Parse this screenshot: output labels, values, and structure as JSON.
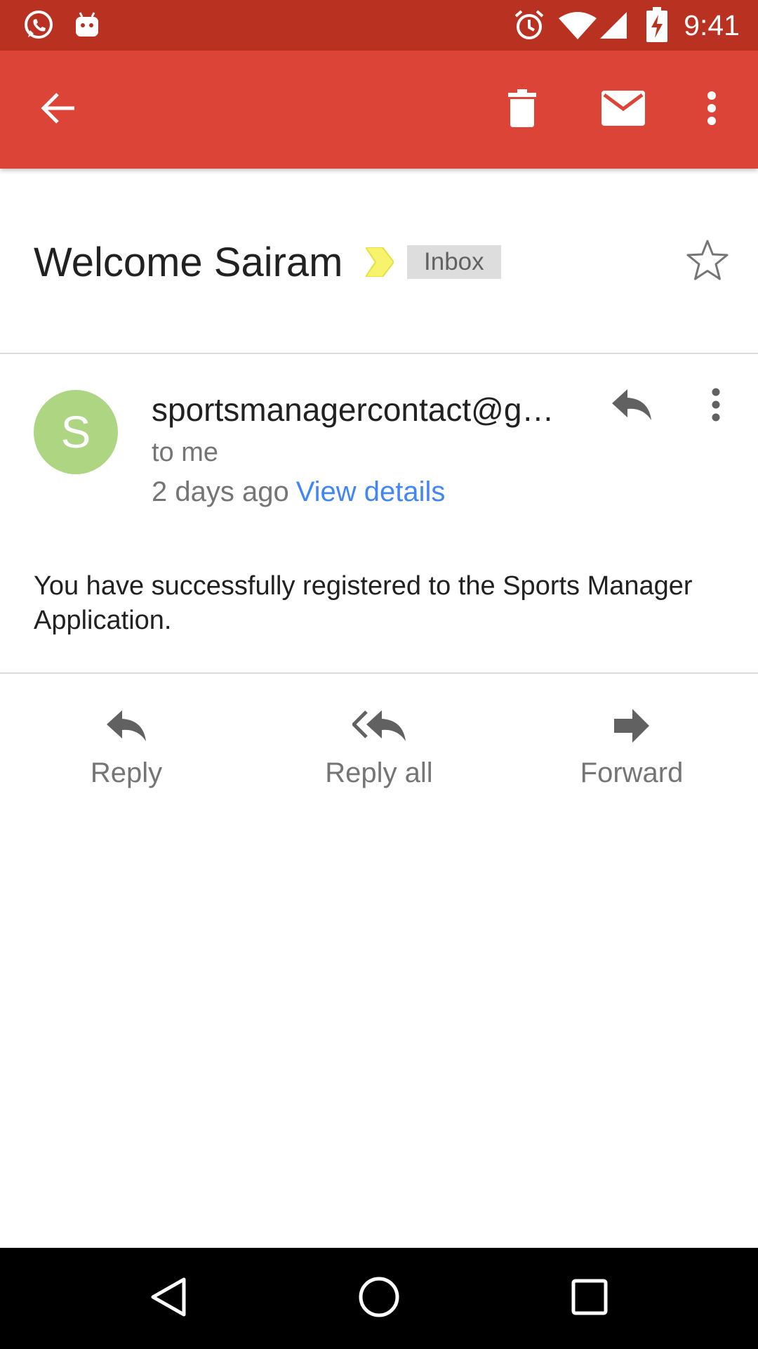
{
  "status_bar": {
    "time": "9:41",
    "icons": [
      "whatsapp-icon",
      "android-icon",
      "alarm-icon",
      "wifi-icon",
      "cell-signal-icon",
      "battery-charging-icon"
    ]
  },
  "app_bar": {
    "icons": [
      "back-arrow-icon",
      "delete-icon",
      "mail-icon",
      "more-vert-icon"
    ],
    "colors": {
      "status_bar": "#b93221",
      "toolbar": "#db4437"
    }
  },
  "subject": {
    "title": "Welcome Sairam",
    "label": "Inbox",
    "marker_color": "#f8f36c"
  },
  "message": {
    "avatar_letter": "S",
    "avatar_color": "#aed581",
    "sender": "sportsmanagercontact@g…",
    "recipient": "to me",
    "time": "2 days ago",
    "view_details": "View details",
    "link_color": "#4285f4",
    "body": "You have successfully registered to the Sports Manager Application."
  },
  "actions": {
    "reply": "Reply",
    "reply_all": "Reply all",
    "forward": "Forward"
  },
  "nav_bar": {
    "icons": [
      "back-icon",
      "home-icon",
      "recents-icon"
    ]
  }
}
